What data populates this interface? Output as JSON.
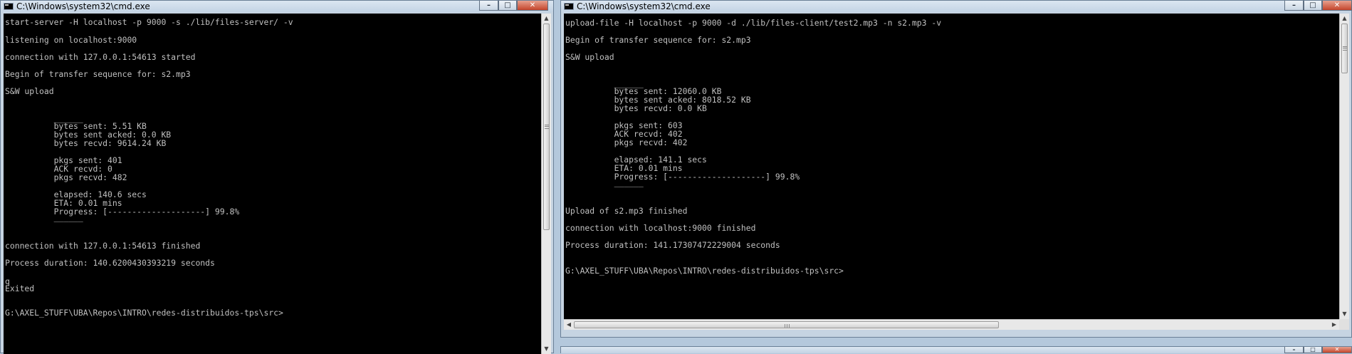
{
  "left_window": {
    "title": "C:\\Windows\\system32\\cmd.exe",
    "controls": {
      "minimize": "–",
      "maximize": "□",
      "close": "✕"
    },
    "lines": [
      "start-server -H localhost -p 9000 -s ./lib/files-server/ -v",
      "listening on localhost:9000",
      "connection with 127.0.0.1:54613 started",
      "Begin of transfer sequence for: s2.mp3",
      "S&W upload",
      "          ______",
      "          bytes sent: 5.51 KB",
      "          bytes sent acked: 0.0 KB",
      "          bytes recvd: 9614.24 KB",
      "          pkgs sent: 401",
      "          ACK recvd: 0",
      "          pkgs recvd: 482",
      "          elapsed: 140.6 secs",
      "          ETA: 0.01 mins",
      "          Progress: [--------------------] 99.8%",
      "          ______",
      "connection with 127.0.0.1:54613 finished",
      "Process duration: 140.6200430393219 seconds",
      "q",
      "Exited",
      "G:\\AXEL_STUFF\\UBA\\Repos\\INTRO\\redes-distribuidos-tps\\src>"
    ]
  },
  "right_window": {
    "title": "C:\\Windows\\system32\\cmd.exe",
    "controls": {
      "minimize": "–",
      "maximize": "□",
      "close": "✕"
    },
    "lines": [
      "upload-file -H localhost -p 9000 -d ./lib/files-client/test2.mp3 -n s2.mp3 -v",
      "Begin of transfer sequence for: s2.mp3",
      "S&W upload",
      "          ______",
      "          bytes sent: 12060.0 KB",
      "          bytes sent acked: 8018.52 KB",
      "          bytes recvd: 0.0 KB",
      "          pkgs sent: 603",
      "          ACK recvd: 402",
      "          pkgs recvd: 402",
      "          elapsed: 141.1 secs",
      "          ETA: 0.01 mins",
      "          Progress: [--------------------] 99.8%",
      "          ______",
      "Upload of s2.mp3 finished",
      "connection with localhost:9000 finished",
      "Process duration: 141.17307472229004 seconds",
      "G:\\AXEL_STUFF\\UBA\\Repos\\INTRO\\redes-distribuidos-tps\\src>"
    ]
  },
  "bottom_window": {
    "controls": {
      "minimize": "–",
      "maximize": "□",
      "close": "✕"
    }
  },
  "scroll_arrows": {
    "up": "▲",
    "down": "▼",
    "left": "◀",
    "right": "▶"
  },
  "colors": {
    "console_bg": "#000000",
    "console_text": "#c0c0c0",
    "frame": "#c6d4e2",
    "close_button": "#c4452c"
  }
}
